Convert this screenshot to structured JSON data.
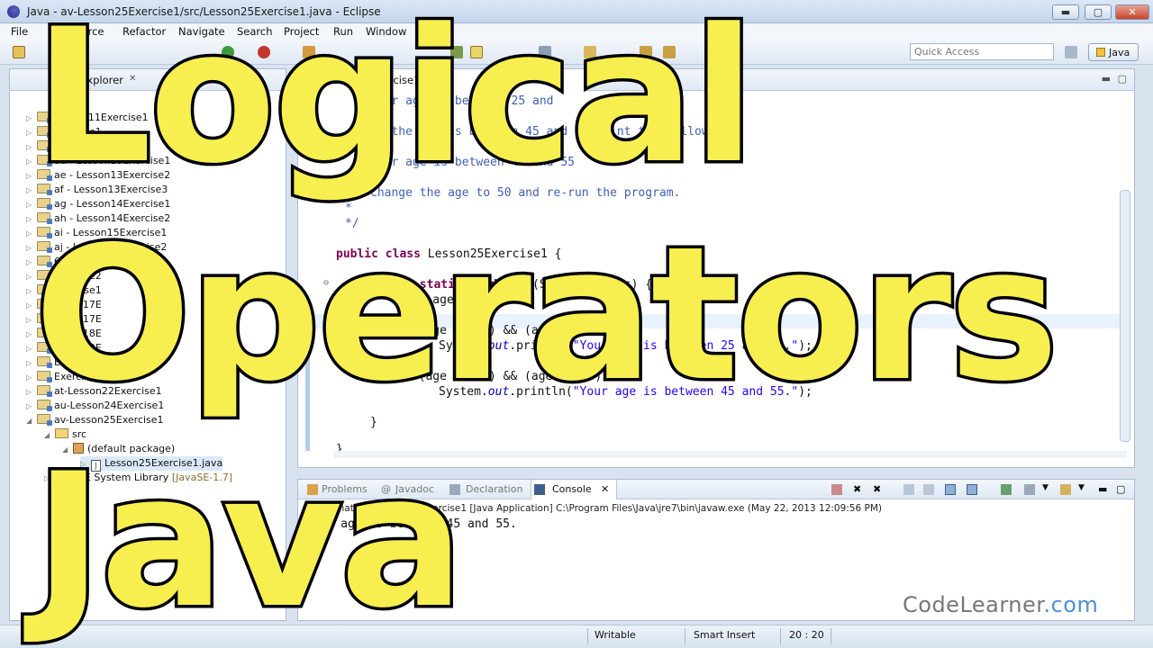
{
  "window": {
    "title": "Java - av-Lesson25Exercise1/src/Lesson25Exercise1.java - Eclipse",
    "minimize": "▬",
    "restore": "▢",
    "close": "✕"
  },
  "menu": {
    "items": [
      "File",
      "Source",
      "Refactor",
      "Navigate",
      "Search",
      "Project",
      "Run",
      "Window"
    ]
  },
  "toolbar": {
    "quick_access_placeholder": "Quick Access",
    "perspective_label": "Java"
  },
  "explorer": {
    "tab_label": "Explorer",
    "items": [
      {
        "label": "Lesson11Exercise1",
        "indent": 0
      },
      {
        "label": "Exercise1",
        "indent": 0
      },
      {
        "label": "Exercise2",
        "indent": 0
      },
      {
        "label": "ad - Lesson13Exercise1",
        "indent": 0
      },
      {
        "label": "ae - Lesson13Exercise2",
        "indent": 0
      },
      {
        "label": "af - Lesson13Exercise3",
        "indent": 0
      },
      {
        "label": "ag - Lesson14Exercise1",
        "indent": 0
      },
      {
        "label": "ah - Lesson14Exercise2",
        "indent": 0
      },
      {
        "label": "ai - Lesson15Exercise1",
        "indent": 0
      },
      {
        "label": "aj - Lesson15Exercise2",
        "indent": 0
      },
      {
        "label": "6Exercise1",
        "indent": 0
      },
      {
        "label": "Exercise2",
        "indent": 0
      },
      {
        "label": "Exercise1",
        "indent": 0
      },
      {
        "label": "esson17E",
        "indent": 0
      },
      {
        "label": "esson17E",
        "indent": 0
      },
      {
        "label": "esson18E",
        "indent": 0
      },
      {
        "label": "esson19E",
        "indent": 0
      },
      {
        "label": "Exercise1",
        "indent": 0
      },
      {
        "label": "Exercise1",
        "indent": 0
      },
      {
        "label": "at-Lesson22Exercise1",
        "indent": 0
      },
      {
        "label": "au-Lesson24Exercise1",
        "indent": 0
      },
      {
        "label": "av-Lesson25Exercise1",
        "indent": 0,
        "open": true
      },
      {
        "label": "src",
        "indent": 1,
        "open": true
      },
      {
        "label": "(default package)",
        "indent": 2,
        "open": true
      },
      {
        "label": "Lesson25Exercise1.java",
        "indent": 3
      },
      {
        "label": "JRE System Library",
        "indent": 1,
        "suffix": "[JavaSE-1.7]"
      }
    ]
  },
  "editor": {
    "tab_label": "Lesson25Exercise1",
    "code": {
      "l1": "Your age is between 25 and",
      "l2": "If the age is between 45 and 55 print the following:",
      "l3": "Your age is between 45 and 55",
      "l4": "Change the age to 50 and re-run the program.",
      "l5": "*",
      "l6": "*/",
      "l7_kw": "public class",
      "l7_rest": " Lesson25Exercise1 {",
      "l8_kw": "public static void",
      "l8_rest": " main(String[] args) {",
      "l9_kw": "int",
      "l9_rest": " age = 50;",
      "l10_kw": "if",
      "l10_rest": "(age >= 25) && (age <= 35)",
      "l11_pre": "System.",
      "l11_out": "out",
      "l11_mid": ".println(",
      "l11_str": "\"Your age is between 25 and 35.\"",
      "l11_end": ");",
      "l12_kw": "if",
      "l12_rest": "(age >= 45) && (age <= 55)",
      "l13_pre": "System.",
      "l13_out": "out",
      "l13_mid": ".println(",
      "l13_str": "\"Your age is between 45 and 55.\"",
      "l13_end": ");",
      "l14": "}",
      "l15": "}"
    }
  },
  "console": {
    "tabs": [
      {
        "label": "Problems"
      },
      {
        "label": "Javadoc"
      },
      {
        "label": "Declaration"
      },
      {
        "label": "Console",
        "active": true
      }
    ],
    "info": "<terminated> Lesson25Exercise1 [Java Application] C:\\Program Files\\Java\\jre7\\bin\\javaw.exe (May 22, 2013 12:09:56 PM)",
    "output": "Your age is between 45 and 55."
  },
  "status": {
    "writable": "Writable",
    "insert_mode": "Smart Insert",
    "position": "20 : 20"
  },
  "overlay": {
    "line1": "Logical",
    "line2": "Operators",
    "line3": "Java"
  },
  "watermark": {
    "brand": "CodeLearner",
    "tld": ".com"
  },
  "colors": {
    "overlay_fill": "#f7ef50",
    "keyword": "#7f0055",
    "comment": "#3f5fbf",
    "string": "#2a00ff"
  }
}
